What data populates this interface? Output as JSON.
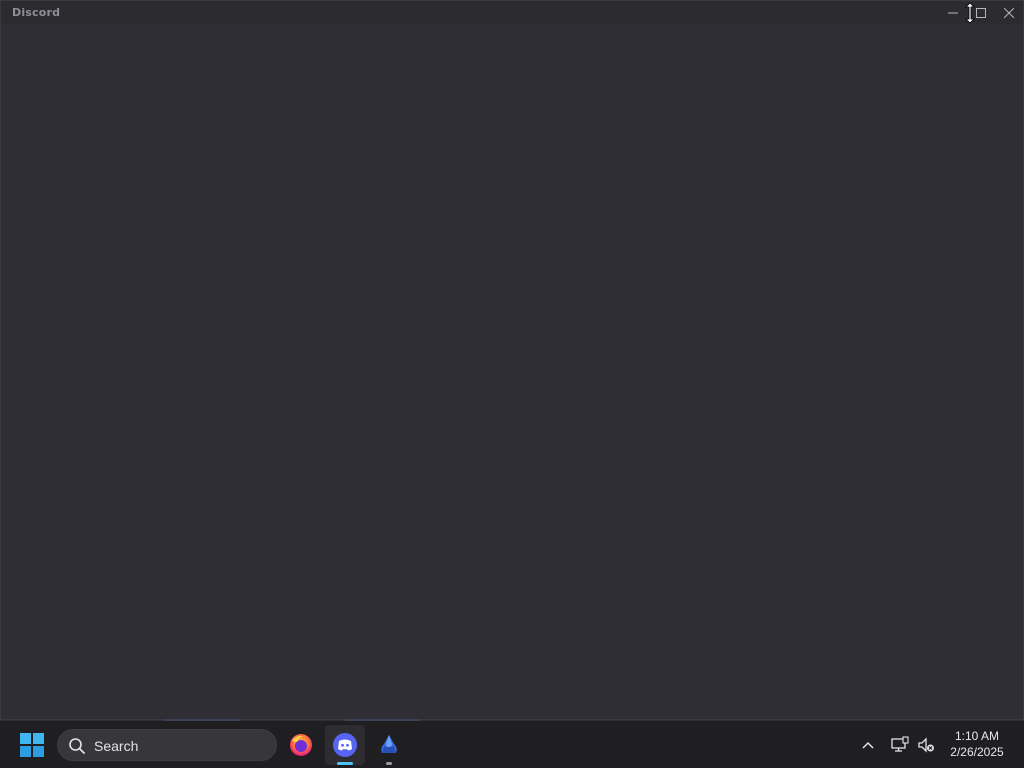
{
  "window": {
    "title": "Discord",
    "controls": {
      "minimize": "minimize-icon",
      "maximize": "maximize-icon",
      "close": "close-icon"
    }
  },
  "taskbar": {
    "search": {
      "placeholder": "Search"
    },
    "apps": [
      {
        "name": "Firefox",
        "icon": "firefox-icon",
        "active": false
      },
      {
        "name": "Discord",
        "icon": "discord-icon",
        "active": true
      },
      {
        "name": "App",
        "icon": "blue-app-icon",
        "active": false
      }
    ],
    "tray": {
      "chevron": "chevron-up-icon",
      "network": "network-icon",
      "volume": "volume-muted-icon"
    },
    "clock": {
      "time": "1:10 AM",
      "date": "2/26/2025"
    }
  },
  "colors": {
    "window_bg": "#2e2e34",
    "taskbar_bg": "#1f1f22",
    "accent": "#5865f2",
    "active_indicator": "#4fc3f7"
  }
}
